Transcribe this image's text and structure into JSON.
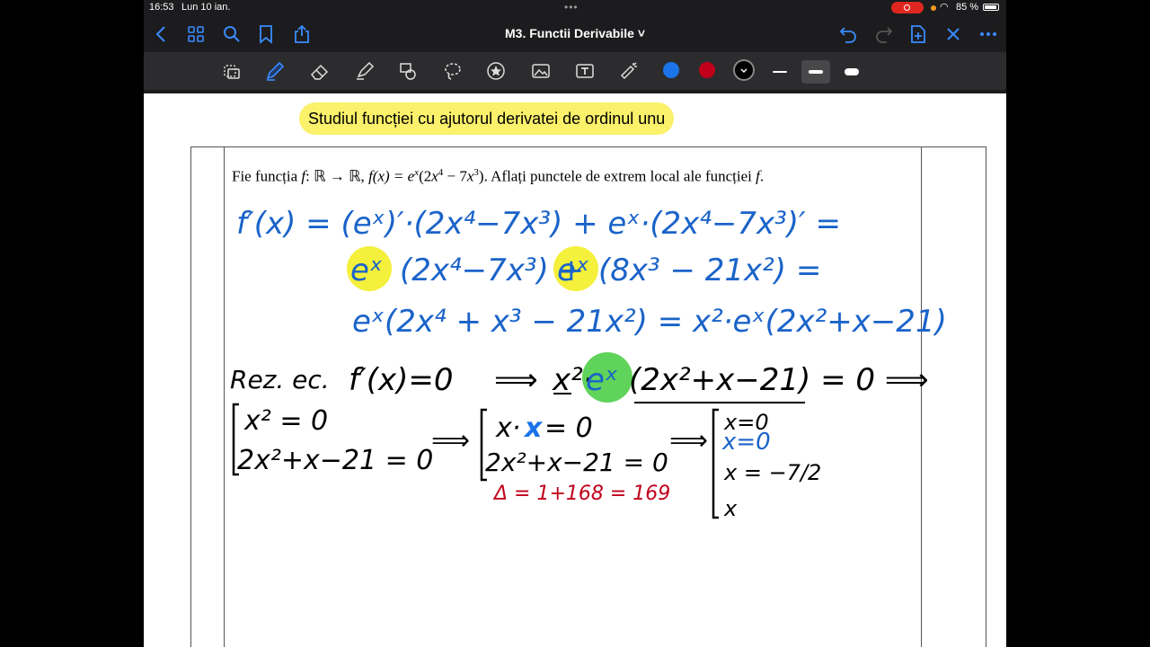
{
  "status": {
    "time": "16:53",
    "date": "Lun 10 ian.",
    "battery": "85 %"
  },
  "navbar": {
    "title": "M3. Functii Derivabile ˅"
  },
  "toolbar": {
    "tools": [
      "lasso-select-icon",
      "pen-icon",
      "eraser-icon",
      "highlighter-icon",
      "shapes-icon",
      "lasso-icon",
      "star-sticker-icon",
      "image-icon",
      "text-box-icon",
      "laser-pointer-icon"
    ],
    "colors": [
      "#1a73e8",
      "#c0001a",
      "#000000"
    ]
  },
  "page": {
    "heading": "Studiul funcției cu ajutorul derivatei de ordinul unu",
    "problem": {
      "text1": "Fie funcția ",
      "math1": "f",
      "text2": ": ℝ → ℝ, ",
      "math2": "f(x) = e",
      "sup1": "x",
      "text3": "(2",
      "math3": "x",
      "sup2": "4",
      "text4": " − 7",
      "math4": "x",
      "sup3": "3",
      "text5": "). Aflați punctele de extrem local ale funcției ",
      "math5": "f",
      "text6": "."
    },
    "handwriting": {
      "line1": "f′(x) = (eˣ)′·(2x⁴−7x³) + eˣ·(2x⁴−7x³)′ =",
      "line2_a": "eˣ",
      "line2_b": "(2x⁴−7x³) + ",
      "line2_c": "eˣ",
      "line2_d": "(8x³ − 21x²) =",
      "line3": "eˣ(2x⁴ + x³ − 21x²) = x²·eˣ(2x²+x−21)",
      "line4_a": "Rez. ec.",
      "line4_b": "f′(x)=0",
      "line4_c": "⟹",
      "line4_d": "x²·",
      "line4_e": "eˣ",
      "line4_f": "(2x²+x−21) = 0 ⟹",
      "sys1_a": "x² = 0",
      "sys1_b": "2x²+x−21 = 0",
      "arrow1": "⟹",
      "sys2_a1": "x·",
      "sys2_a2": "x",
      "sys2_a3": " = 0",
      "sys2_b": "2x²+x−21 = 0",
      "delta": "Δ = 1+168 = 169",
      "arrow2": "⟹",
      "sys3_a": "x=0",
      "sys3_b": "x=0",
      "sys3_c": "x = −7/2",
      "sys3_d": "x"
    }
  },
  "colors": {
    "ink_blue": "#1a63c9",
    "ink_black": "#000000",
    "ink_red": "#c0001a",
    "highlight_yellow": "#f4f03c",
    "highlight_green": "#5fd35a"
  }
}
